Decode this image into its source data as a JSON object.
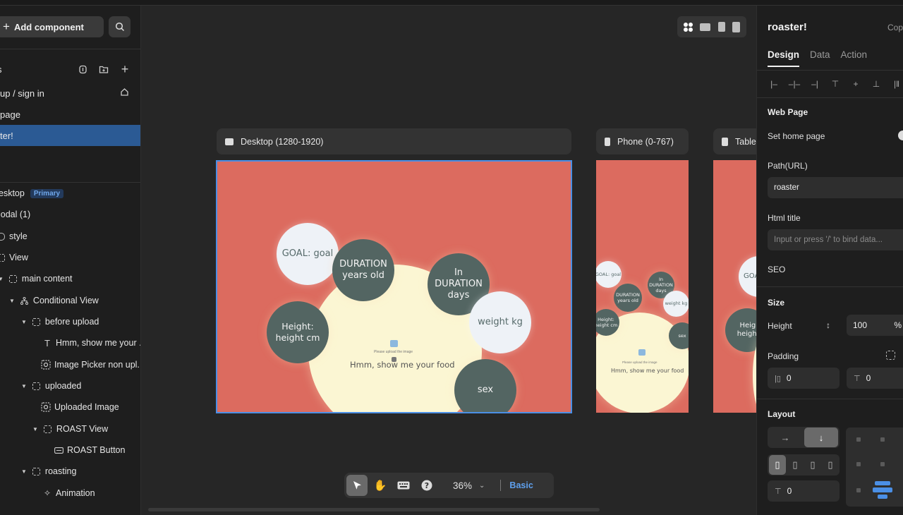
{
  "left": {
    "add_component": "Add component",
    "pages_header": "s",
    "pages": [
      {
        "label": "up / sign in"
      },
      {
        "label": " page"
      },
      {
        "label": "ter!"
      }
    ],
    "tree": [
      {
        "label": "esktop",
        "badge": "Primary"
      },
      {
        "label": "lodal (1)"
      },
      {
        "label": "style"
      },
      {
        "label": "View"
      },
      {
        "label": "main content"
      },
      {
        "label": "Conditional View"
      },
      {
        "label": "before upload"
      },
      {
        "label": "Hmm, show me your ..."
      },
      {
        "label": "Image Picker non upl..."
      },
      {
        "label": "uploaded"
      },
      {
        "label": "Uploaded Image"
      },
      {
        "label": "ROAST View"
      },
      {
        "label": "ROAST Button"
      },
      {
        "label": "roasting"
      },
      {
        "label": "Animation"
      }
    ]
  },
  "canvas": {
    "frames": [
      {
        "label": "Desktop (1280-1920)"
      },
      {
        "label": "Phone (0-767)"
      },
      {
        "label": "Table"
      }
    ],
    "bubbles": {
      "goal": "GOAL: goal",
      "duration_years": "DURATION years old",
      "in_duration_days": "In DURATION days",
      "height": "Height: height cm",
      "weight": "weight kg",
      "sex": "sex"
    },
    "phone_bubbles": {
      "height": "Height: height cm"
    },
    "tablet_bubbles": {
      "goal": "GOA",
      "height": "Height height c"
    },
    "upload_hint": "Please upload the image",
    "food_text": "Hmm, show me your food"
  },
  "toolbar": {
    "zoom": "36%",
    "mode": "Basic"
  },
  "right": {
    "title": "roaster!",
    "copy": "Cop",
    "tabs": [
      "Design",
      "Data",
      "Action"
    ],
    "web_page_section": "Web Page",
    "set_home_page": "Set home page",
    "path_label": "Path(URL)",
    "path_value": "roaster",
    "html_title_label": "Html title",
    "html_title_placeholder": "Input or press '/' to bind data...",
    "seo_label": "SEO",
    "size_section": "Size",
    "height_label": "Height",
    "height_value": "100",
    "height_unit": "%",
    "padding_label": "Padding",
    "padding_left": "0",
    "padding_top": "0",
    "layout_section": "Layout",
    "gap_value": "0"
  }
}
